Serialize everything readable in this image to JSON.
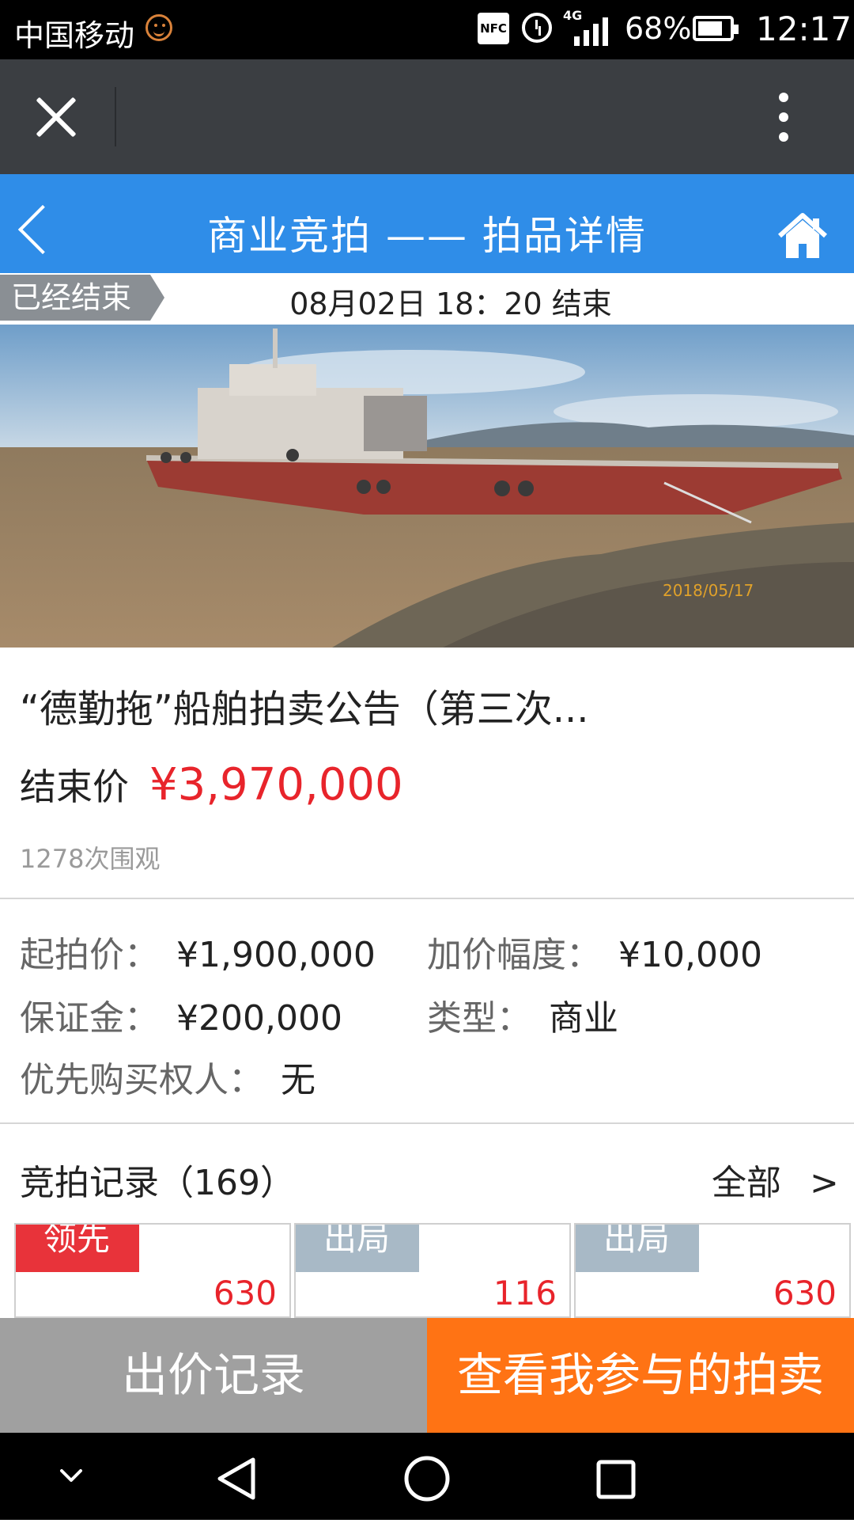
{
  "status_bar": {
    "carrier": "中国移动",
    "nfc": "NFC",
    "network": "4G",
    "battery": "68%",
    "time": "12:17"
  },
  "header": {
    "title": "商业竞拍 —— 拍品详情"
  },
  "auction_status": {
    "tag": "已经结束",
    "end_time": "08月02日 18：20 结束"
  },
  "photo": {
    "date_stamp": "2018/05/17"
  },
  "item": {
    "title": "“德勤拖”船舶拍卖公告（第三次...",
    "price_label": "结束价",
    "price": "¥3,970,000",
    "views": "1278次围观"
  },
  "details": {
    "start_price_label": "起拍价：",
    "start_price": "¥1,900,000",
    "increment_label": "加价幅度：",
    "increment": "¥10,000",
    "deposit_label": "保证金：",
    "deposit": "¥200,000",
    "type_label": "类型：",
    "type": "商业",
    "priority_label": "优先购买权人：",
    "priority": "无"
  },
  "records": {
    "title": "竞拍记录（169）",
    "all_label": "全部",
    "all_arrow": ">",
    "cards": [
      {
        "badge": "领先",
        "number": "630",
        "badge_color": "#e8333a"
      },
      {
        "badge": "出局",
        "number": "116",
        "badge_color": "#a8b9c6"
      },
      {
        "badge": "出局",
        "number": "630",
        "badge_color": "#a8b9c6"
      }
    ]
  },
  "actions": {
    "bid_history": "出价记录",
    "my_auctions": "查看我参与的拍卖"
  },
  "colors": {
    "header_blue": "#2f8de8",
    "price_red": "#e8242b",
    "action_orange": "#ff7314",
    "action_gray": "#a0a0a0"
  }
}
